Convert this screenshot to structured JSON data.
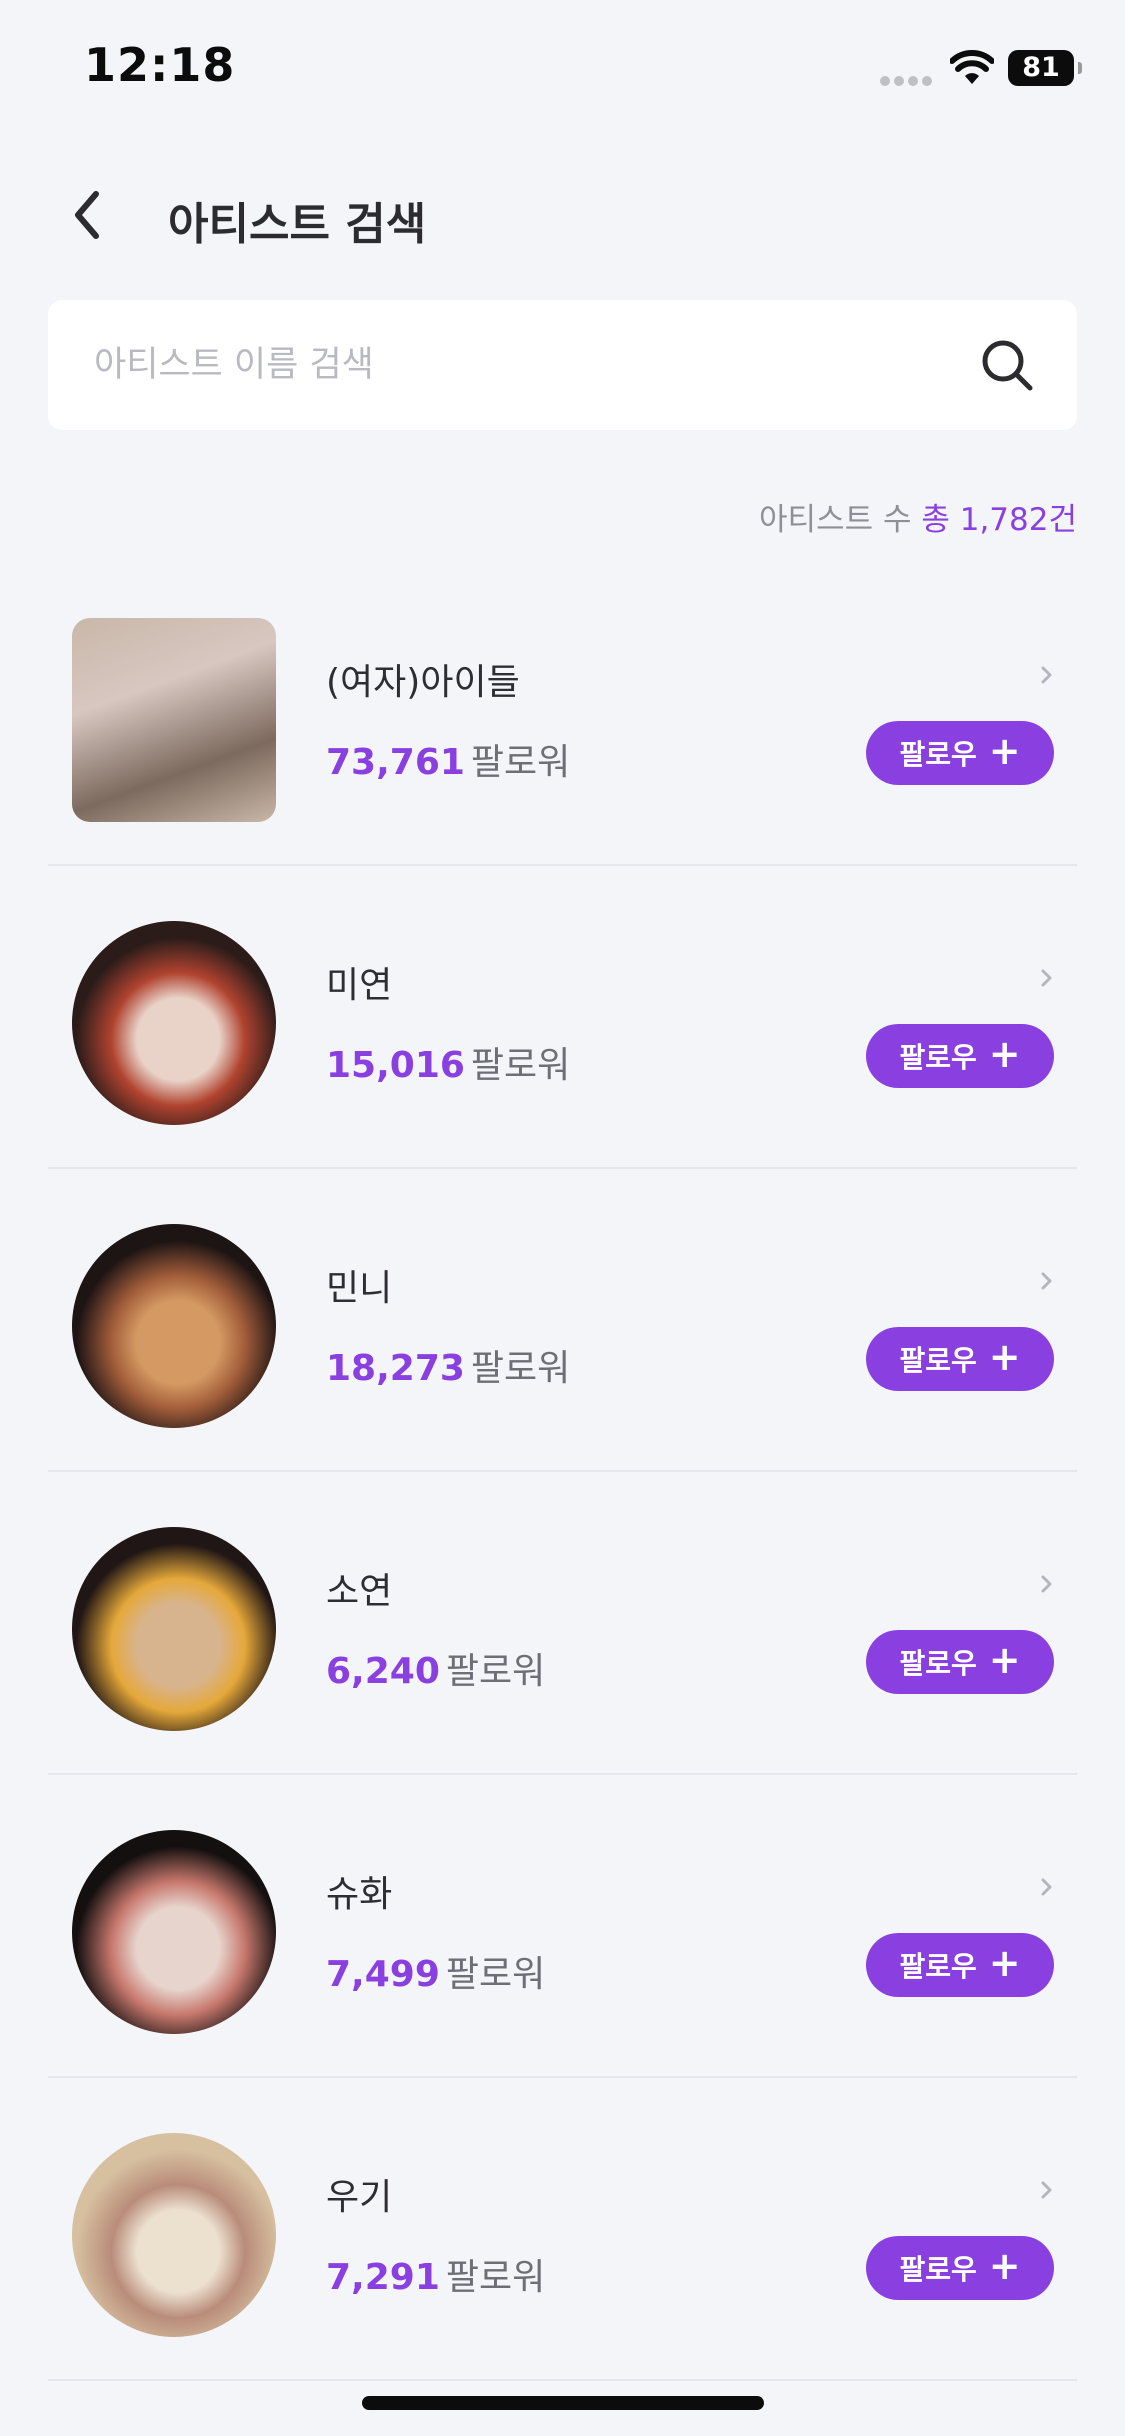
{
  "status_bar": {
    "time": "12:18",
    "battery": "81"
  },
  "header": {
    "title": "아티스트 검색"
  },
  "search": {
    "placeholder": "아티스트 이름 검색",
    "value": ""
  },
  "count": {
    "prefix": "아티스트 수",
    "highlight": "총 1,782건"
  },
  "artists": [
    {
      "name": "(여자)아이들",
      "followers": "73,761",
      "unit": "팔로워",
      "follow_label": "팔로우",
      "avatar_shape": "square",
      "avatar_colors": [
        "#c9b7a8",
        "#7c6a5e",
        "#d8c7c1"
      ]
    },
    {
      "name": "미연",
      "followers": "15,016",
      "unit": "팔로워",
      "follow_label": "팔로우",
      "avatar_shape": "round",
      "avatar_colors": [
        "#e9d2c8",
        "#2b1c1a",
        "#b0432f"
      ]
    },
    {
      "name": "민니",
      "followers": "18,273",
      "unit": "팔로워",
      "follow_label": "팔로우",
      "avatar_shape": "round",
      "avatar_colors": [
        "#d59a63",
        "#1d1414",
        "#a25d3a"
      ]
    },
    {
      "name": "소연",
      "followers": "6,240",
      "unit": "팔로워",
      "follow_label": "팔로우",
      "avatar_shape": "round",
      "avatar_colors": [
        "#d8b48e",
        "#201615",
        "#e5a83a"
      ]
    },
    {
      "name": "슈화",
      "followers": "7,499",
      "unit": "팔로워",
      "follow_label": "팔로우",
      "avatar_shape": "round",
      "avatar_colors": [
        "#e7d4cd",
        "#141010",
        "#c7786d"
      ]
    },
    {
      "name": "우기",
      "followers": "7,291",
      "unit": "팔로워",
      "follow_label": "팔로우",
      "avatar_shape": "round",
      "avatar_colors": [
        "#ece0cf",
        "#d6c0a0",
        "#b98c7a"
      ]
    }
  ],
  "colors": {
    "accent": "#8a40e0",
    "background": "#f4f5f9"
  }
}
